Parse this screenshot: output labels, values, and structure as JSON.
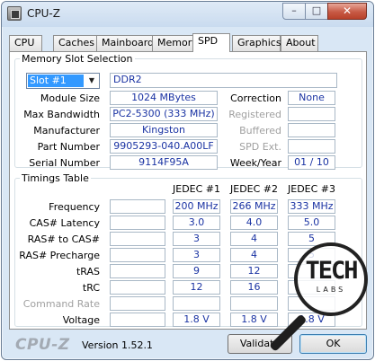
{
  "window": {
    "title": "CPU-Z",
    "minimize": "–",
    "maximize": "□",
    "close": "✕"
  },
  "tabs": [
    "CPU",
    "Caches",
    "Mainboard",
    "Memory",
    "SPD",
    "Graphics",
    "About"
  ],
  "active_tab": "SPD",
  "slot_section": {
    "title": "Memory Slot Selection",
    "slot_selected": "Slot #1",
    "memory_type": "DDR2",
    "module_size": {
      "label": "Module Size",
      "value": "1024 MBytes"
    },
    "max_bandwidth": {
      "label": "Max Bandwidth",
      "value": "PC2-5300 (333 MHz)"
    },
    "manufacturer": {
      "label": "Manufacturer",
      "value": "Kingston"
    },
    "part_number": {
      "label": "Part Number",
      "value": "9905293-040.A00LF"
    },
    "serial_number": {
      "label": "Serial Number",
      "value": "9114F95A"
    },
    "correction": {
      "label": "Correction",
      "value": "None"
    },
    "registered": {
      "label": "Registered",
      "value": ""
    },
    "buffered": {
      "label": "Buffered",
      "value": ""
    },
    "spd_ext": {
      "label": "SPD Ext.",
      "value": ""
    },
    "week_year": {
      "label": "Week/Year",
      "value": "01 / 10"
    }
  },
  "timings": {
    "title": "Timings Table",
    "columns": [
      "JEDEC #1",
      "JEDEC #2",
      "JEDEC #3"
    ],
    "rows": [
      {
        "label": "Frequency",
        "values": [
          "200 MHz",
          "266 MHz",
          "333 MHz"
        ]
      },
      {
        "label": "CAS# Latency",
        "values": [
          "3.0",
          "4.0",
          "5.0"
        ]
      },
      {
        "label": "RAS# to CAS#",
        "values": [
          "3",
          "4",
          "5"
        ]
      },
      {
        "label": "RAS# Precharge",
        "values": [
          "3",
          "4",
          "5"
        ]
      },
      {
        "label": "tRAS",
        "values": [
          "9",
          "12",
          ""
        ]
      },
      {
        "label": "tRC",
        "values": [
          "12",
          "16",
          ""
        ]
      },
      {
        "label": "Command Rate",
        "values": [
          "",
          "",
          ""
        ]
      },
      {
        "label": "Voltage",
        "values": [
          "1.8 V",
          "1.8 V",
          "1.8 V"
        ]
      }
    ]
  },
  "footer": {
    "logo": "CPU-Z",
    "version": "Version 1.52.1",
    "validate_label": "Validate",
    "ok_label": "OK"
  },
  "watermark": {
    "word": "TECH",
    "sub": "LABS"
  }
}
